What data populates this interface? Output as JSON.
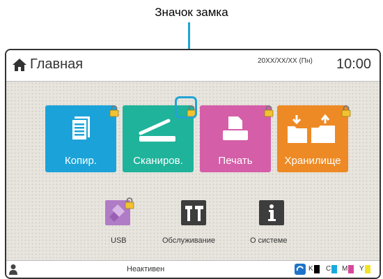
{
  "callout_label": "Значок замка",
  "header": {
    "title": "Главная",
    "date": "20XX/XX/XX (Пн)",
    "time": "10:00",
    "home_icon": "home-icon"
  },
  "tiles": [
    {
      "label": "Копир.",
      "color": "#1ba3d9",
      "icon": "copy-icon",
      "locked": true
    },
    {
      "label": "Сканиров.",
      "color": "#1fb39b",
      "icon": "scanner-icon",
      "locked": true
    },
    {
      "label": "Печать",
      "color": "#d55ea8",
      "icon": "print-icon",
      "locked": true
    },
    {
      "label": "Хранилище",
      "color": "#ee8a25",
      "icon": "storage-folders-icon",
      "locked": true
    }
  ],
  "small_buttons": [
    {
      "label": "USB",
      "color": "#b07cc6",
      "icon": "usb-icon",
      "locked": true
    },
    {
      "label": "Обслуживание",
      "color": "#3d3d3d",
      "icon": "maintenance-tools-icon",
      "locked": false
    },
    {
      "label": "О системе",
      "color": "#3d3d3d",
      "icon": "info-icon",
      "locked": false
    }
  ],
  "status_bar": {
    "status": "Неактивен",
    "user_icon": "user-icon",
    "ink_icon": "ink-level-icon",
    "inks": [
      {
        "label": "K",
        "color": "#000000"
      },
      {
        "label": "C",
        "color": "#19a9e0"
      },
      {
        "label": "M",
        "color": "#d9479a"
      },
      {
        "label": "Y",
        "color": "#f2e324"
      }
    ]
  }
}
